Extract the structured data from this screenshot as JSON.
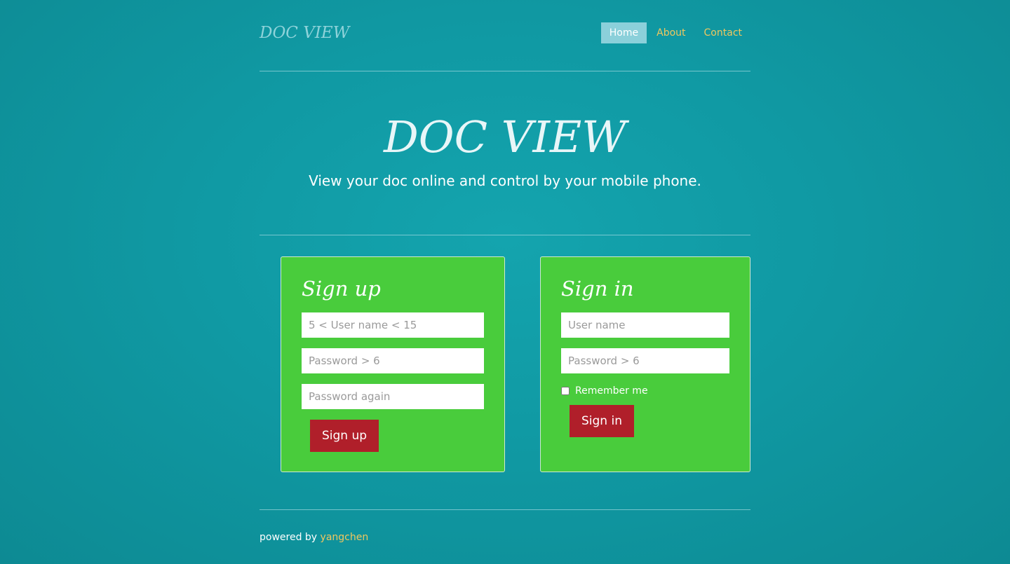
{
  "header": {
    "brand": "DOC VIEW",
    "nav": [
      {
        "label": "Home",
        "active": true
      },
      {
        "label": "About",
        "active": false
      },
      {
        "label": "Contact",
        "active": false
      }
    ]
  },
  "hero": {
    "title": "DOC VIEW",
    "subtitle": "View your doc online and control by your mobile phone."
  },
  "signup": {
    "title": "Sign up",
    "username_placeholder": "5 < User name < 15",
    "password_placeholder": "Password > 6",
    "password_again_placeholder": "Password again",
    "button_label": "Sign up"
  },
  "signin": {
    "title": "Sign in",
    "username_placeholder": "User name",
    "password_placeholder": "Password > 6",
    "remember_label": "Remember me",
    "remember_checked": false,
    "button_label": "Sign in"
  },
  "footer": {
    "prefix": "powered by",
    "author": "yangchen"
  },
  "colors": {
    "background": "#1099a3",
    "card": "#49cc3c",
    "button": "#b01f2a",
    "link": "#f0c75e",
    "nav_active": "#8bd0da"
  }
}
